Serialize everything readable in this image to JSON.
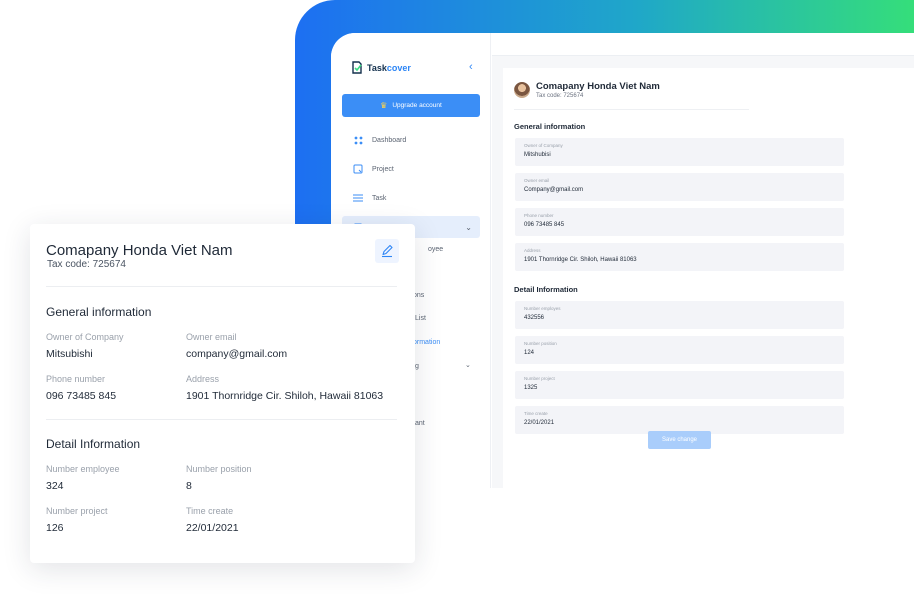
{
  "app": {
    "logo_prefix": "Task",
    "logo_suffix": "cover",
    "upgrade_label": "Upgrade account"
  },
  "sidebar": {
    "items": [
      {
        "label": "Dashboard",
        "icon": "grid-icon"
      },
      {
        "label": "Project",
        "icon": "project-icon"
      },
      {
        "label": "Task",
        "icon": "menu-icon"
      }
    ],
    "fragments": [
      "oyee",
      "ons",
      "List",
      "ormation",
      "g",
      "tant"
    ]
  },
  "panel": {
    "company_name": "Comapany Honda Viet Nam",
    "tax_code": "Tax code: 725674",
    "general_heading": "General information",
    "general_fields": [
      {
        "label": "Owner of Company",
        "value": "Mitshubisi"
      },
      {
        "label": "Owner email",
        "value": "Company@gmail.com"
      },
      {
        "label": "Phone number",
        "value": "096 73485 845"
      },
      {
        "label": "Address",
        "value": "1901 Thornridge Cir. Shiloh, Hawaii 81063"
      }
    ],
    "detail_heading": "Detail Information",
    "detail_fields": [
      {
        "label": "Number employes",
        "value": "432556"
      },
      {
        "label": "Number position",
        "value": "124"
      },
      {
        "label": "Number project",
        "value": "1325"
      },
      {
        "label": "Time create",
        "value": "22/01/2021"
      }
    ],
    "save_label": "Save change"
  },
  "card": {
    "company_name": "Comapany Honda Viet Nam",
    "tax_code": "Tax code: 725674",
    "general_heading": "General information",
    "owner_label": "Owner of Company",
    "owner_value": "Mitsubishi",
    "email_label": "Owner email",
    "email_value": "company@gmail.com",
    "phone_label": "Phone number",
    "phone_value": "096 73485 845",
    "address_label": "Address",
    "address_value": "1901 Thornridge Cir. Shiloh, Hawaii 81063",
    "detail_heading": "Detail Information",
    "employee_label": "Number employee",
    "employee_value": "324",
    "position_label": "Number position",
    "position_value": "8",
    "project_label": "Number project",
    "project_value": "126",
    "time_label": "Time create",
    "time_value": "22/01/2021"
  },
  "colors": {
    "accent": "#3b8ef6",
    "gradient_start": "#1d6ff2",
    "gradient_end": "#35de7a"
  }
}
